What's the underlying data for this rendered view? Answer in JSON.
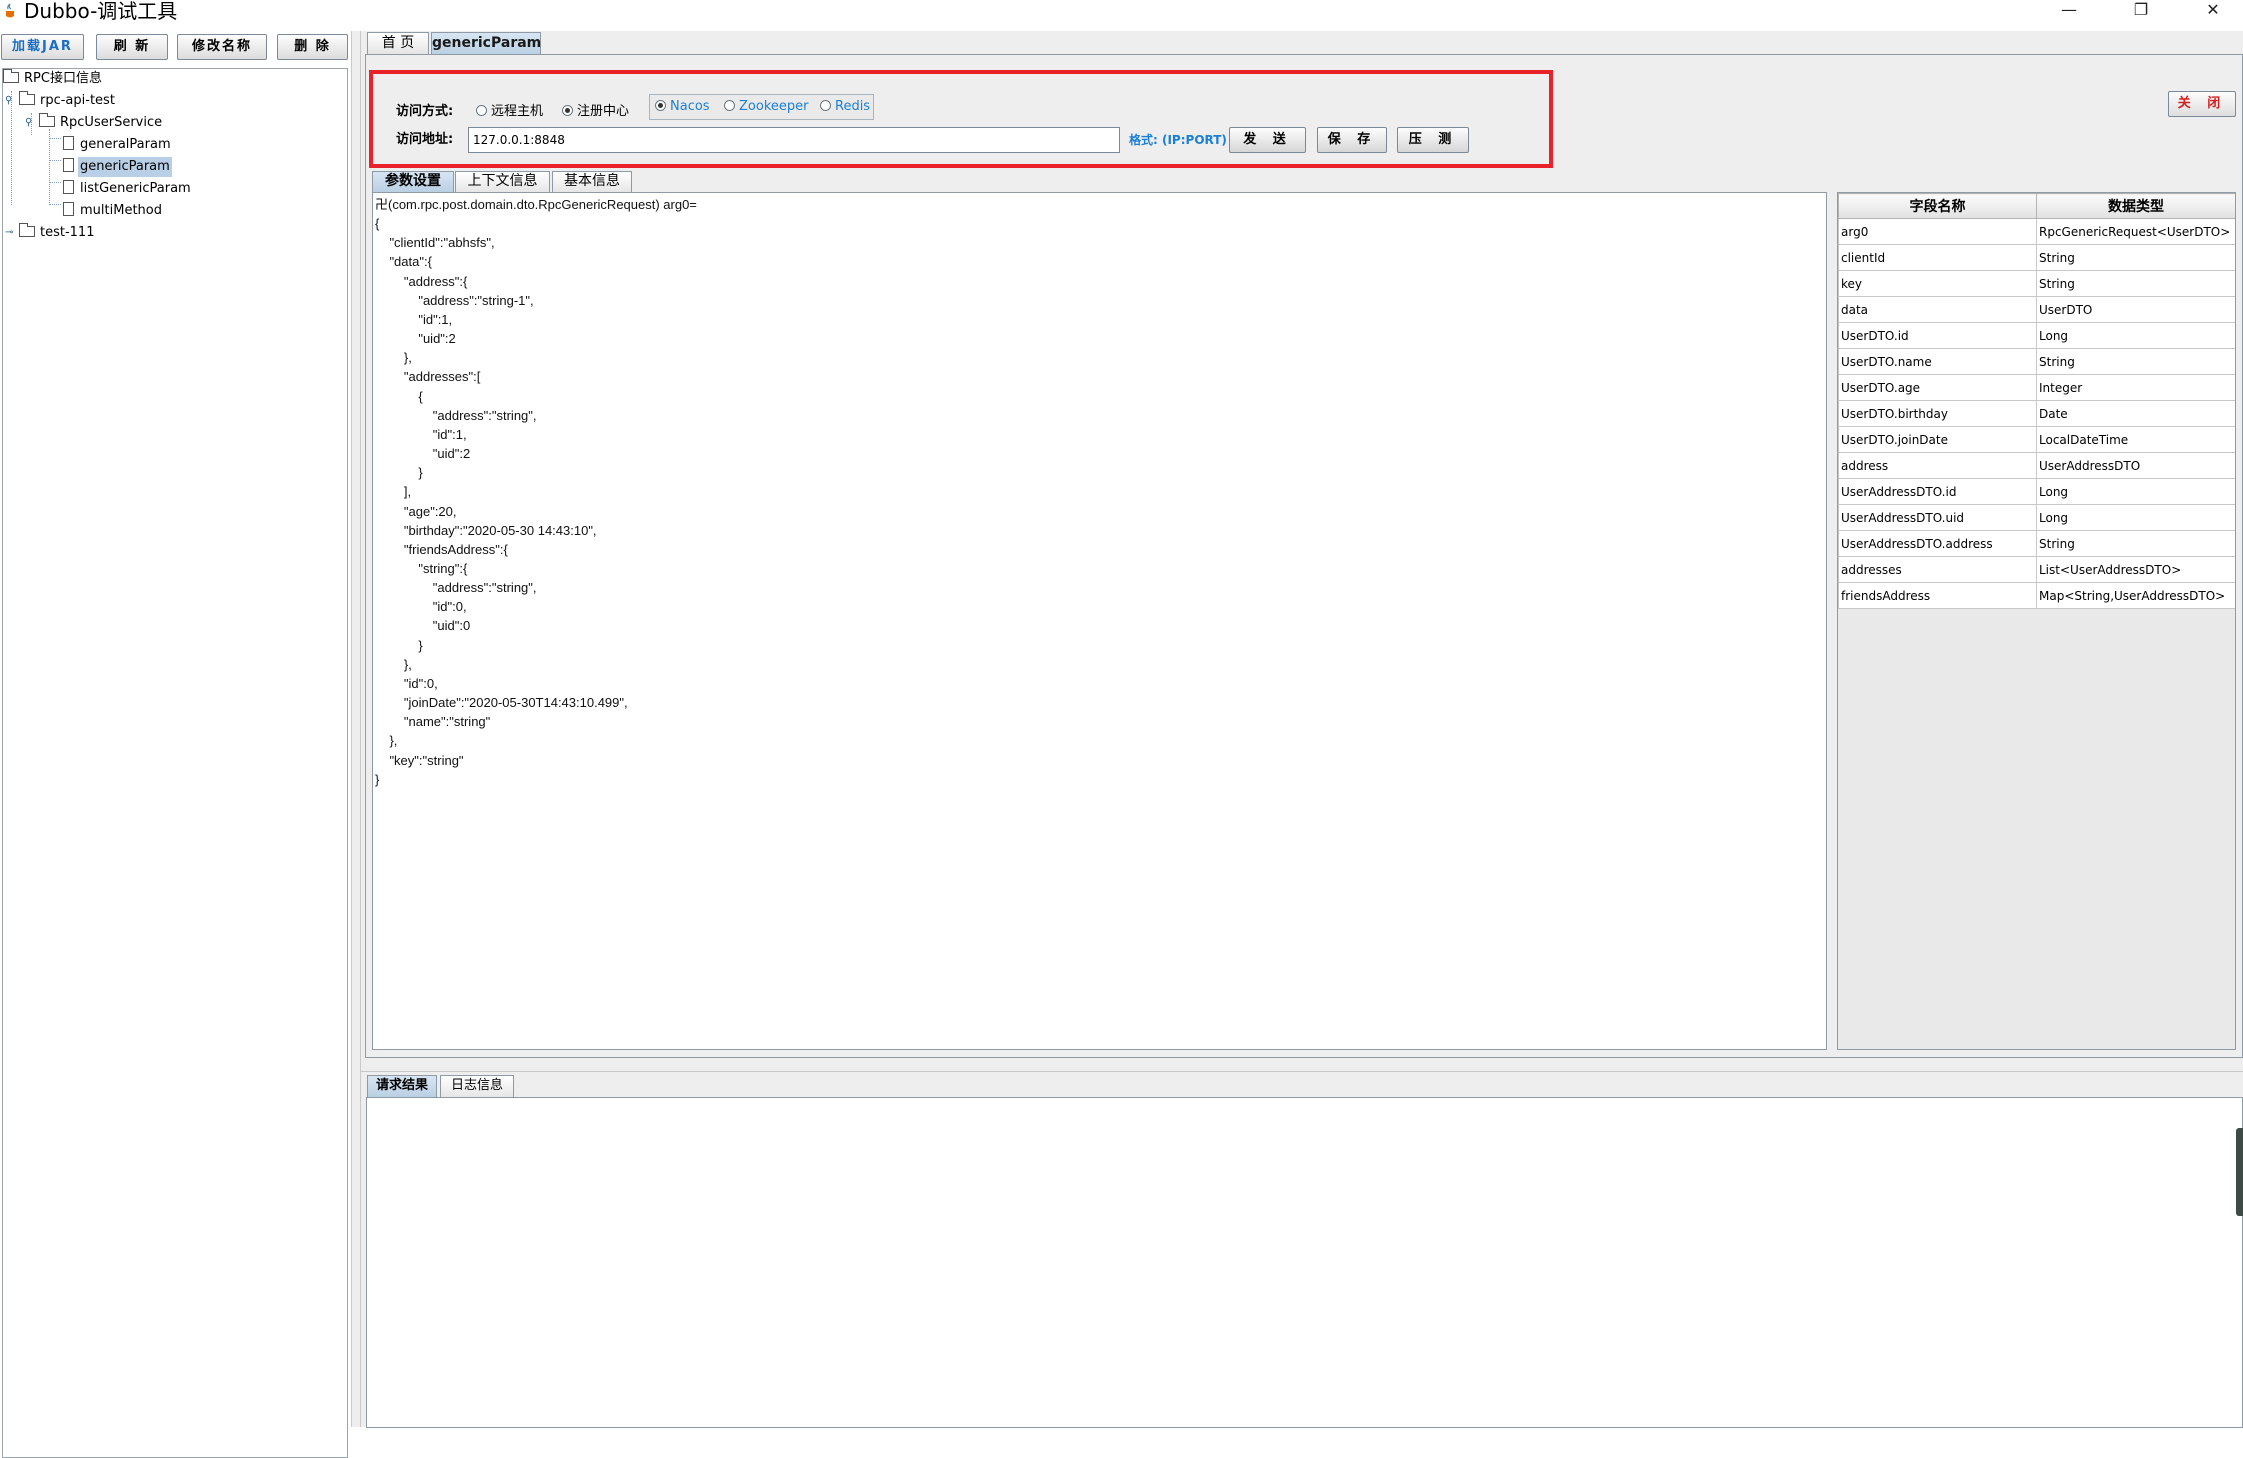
{
  "window": {
    "title": "Dubbo-调试工具",
    "controls": {
      "minimize": "—",
      "maximize": "❐",
      "close": "✕"
    }
  },
  "toolbar": {
    "load_jar": "加载JAR",
    "refresh": "刷 新",
    "rename": "修改名称",
    "delete": "删 除"
  },
  "tree": {
    "root": "RPC接口信息",
    "project1": "rpc-api-test",
    "service": "RpcUserService",
    "methods": [
      "generalParam",
      "genericParam",
      "listGenericParam",
      "multiMethod"
    ],
    "project2": "test-111",
    "selected": "genericParam"
  },
  "tabs": {
    "home": "首 页",
    "current": "genericParam"
  },
  "form": {
    "access_mode_label": "访问方式:",
    "mode_remote": "远程主机",
    "mode_registry": "注册中心",
    "registry_nacos": "Nacos",
    "registry_zookeeper": "Zookeeper",
    "registry_redis": "Redis",
    "selected_mode": "注册中心",
    "selected_registry": "Nacos",
    "address_label": "访问地址:",
    "address_value": "127.0.0.1:8848",
    "format_hint": "格式: (IP:PORT)",
    "send": "发 送",
    "save": "保 存",
    "stress": "压 测",
    "close": "关 闭"
  },
  "sub_tabs": [
    "参数设置",
    "上下文信息",
    "基本信息"
  ],
  "editor": {
    "code": "卍(com.rpc.post.domain.dto.RpcGenericRequest) arg0=\n{\n    \"clientId\":\"abhsfs\",\n    \"data\":{\n        \"address\":{\n            \"address\":\"string-1\",\n            \"id\":1,\n            \"uid\":2\n        },\n        \"addresses\":[\n            {\n                \"address\":\"string\",\n                \"id\":1,\n                \"uid\":2\n            }\n        ],\n        \"age\":20,\n        \"birthday\":\"2020-05-30 14:43:10\",\n        \"friendsAddress\":{\n            \"string\":{\n                \"address\":\"string\",\n                \"id\":0,\n                \"uid\":0\n            }\n        },\n        \"id\":0,\n        \"joinDate\":\"2020-05-30T14:43:10.499\",\n        \"name\":\"string\"\n    },\n    \"key\":\"string\"\n}"
  },
  "field_table": {
    "headers": [
      "字段名称",
      "数据类型"
    ],
    "rows": [
      [
        "arg0",
        "RpcGenericRequest<UserDTO>"
      ],
      [
        "clientId",
        "String"
      ],
      [
        "key",
        "String"
      ],
      [
        "data",
        "UserDTO"
      ],
      [
        "UserDTO.id",
        "Long"
      ],
      [
        "UserDTO.name",
        "String"
      ],
      [
        "UserDTO.age",
        "Integer"
      ],
      [
        "UserDTO.birthday",
        "Date"
      ],
      [
        "UserDTO.joinDate",
        "LocalDateTime"
      ],
      [
        "address",
        "UserAddressDTO"
      ],
      [
        "UserAddressDTO.id",
        "Long"
      ],
      [
        "UserAddressDTO.uid",
        "Long"
      ],
      [
        "UserAddressDTO.address",
        "String"
      ],
      [
        "addresses",
        "List<UserAddressDTO>"
      ],
      [
        "friendsAddress",
        "Map<String,UserAddressDTO>"
      ]
    ]
  },
  "bottom_tabs": [
    "请求结果",
    "日志信息"
  ],
  "colors": {
    "highlight": "#e8212a",
    "accent_blue": "#1a7fd6",
    "close_red": "#d42020",
    "selection": "#b8cfe5"
  }
}
